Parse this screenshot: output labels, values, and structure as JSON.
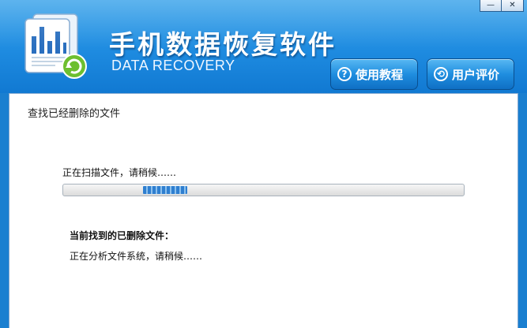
{
  "window": {
    "minimize_label": "—",
    "close_label": "✕"
  },
  "header": {
    "title": "手机数据恢复软件",
    "subtitle": "DATA RECOVERY",
    "logo_icon": "document-chart-recycle-icon",
    "buttons": [
      {
        "label": "使用教程",
        "icon": "?"
      },
      {
        "label": "用户评价",
        "icon": "⟲"
      }
    ]
  },
  "main": {
    "section_title": "查找已经删除的文件",
    "scan_status": "正在扫描文件，请稍候……",
    "found_label": "当前找到的已删除文件：",
    "analyze_status": "正在分析文件系统，请稍候……"
  },
  "colors": {
    "header_blue": "#1e8be0",
    "progress_blue": "#2f7fd0"
  }
}
